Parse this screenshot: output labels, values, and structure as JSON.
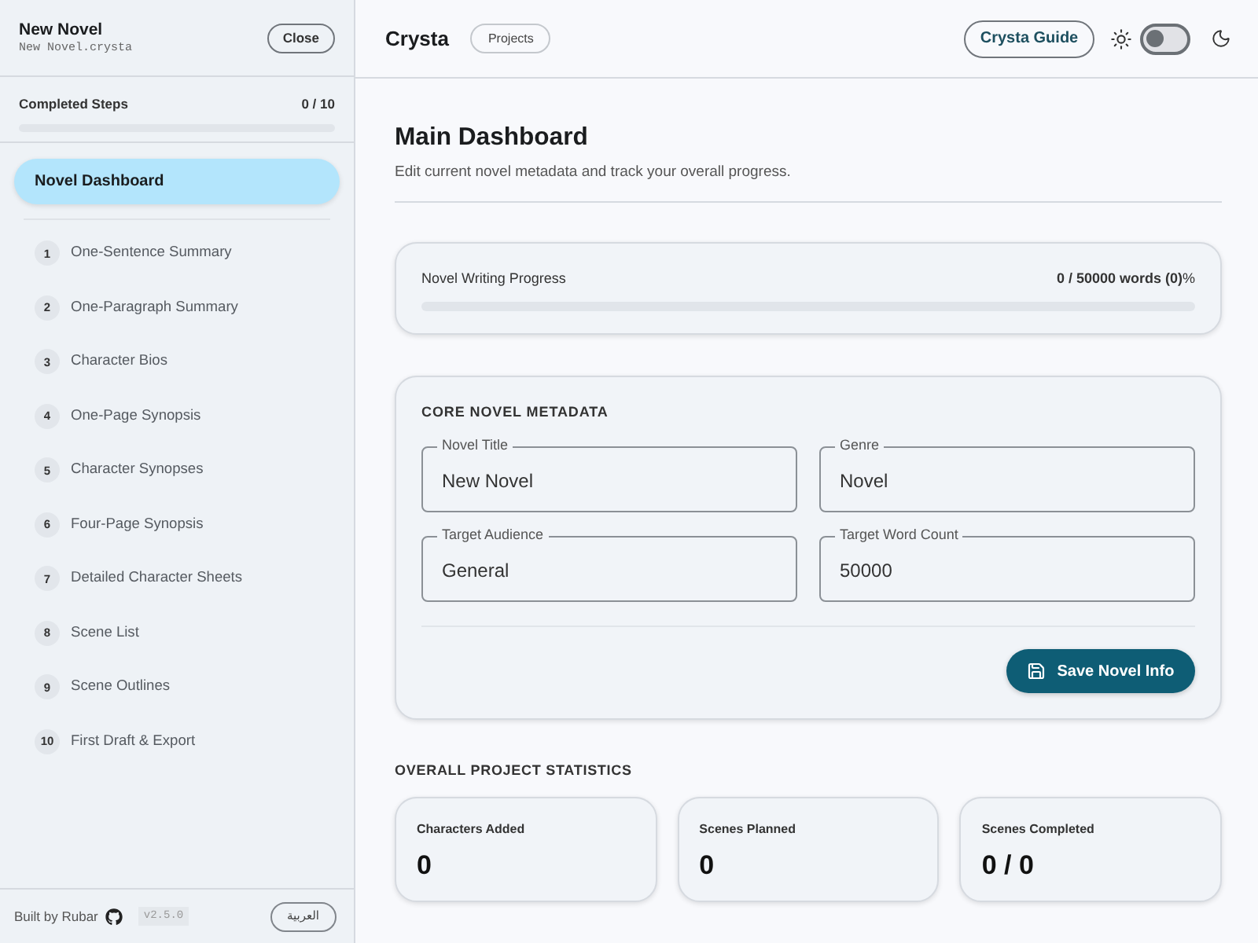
{
  "sidebar": {
    "project_title": "New Novel",
    "project_file": "New Novel.crysta",
    "close_button": "Close",
    "completed_steps": {
      "label": "Completed Steps",
      "count": "0 / 10"
    },
    "nav_items": [
      {
        "kind": "dashboard",
        "label": "Novel Dashboard",
        "selected": true
      },
      {
        "kind": "step",
        "number": "1",
        "label": "One-Sentence Summary",
        "selected": false
      },
      {
        "kind": "step",
        "number": "2",
        "label": "One-Paragraph Summary",
        "selected": false
      },
      {
        "kind": "step",
        "number": "3",
        "label": "Character Bios",
        "selected": false
      },
      {
        "kind": "step",
        "number": "4",
        "label": "One-Page Synopsis",
        "selected": false
      },
      {
        "kind": "step",
        "number": "5",
        "label": "Character Synopses",
        "selected": false
      },
      {
        "kind": "step",
        "number": "6",
        "label": "Four-Page Synopsis",
        "selected": false
      },
      {
        "kind": "step",
        "number": "7",
        "label": "Detailed Character Sheets",
        "selected": false
      },
      {
        "kind": "step",
        "number": "8",
        "label": "Scene List",
        "selected": false
      },
      {
        "kind": "step",
        "number": "9",
        "label": "Scene Outlines",
        "selected": false
      },
      {
        "kind": "step",
        "number": "10",
        "label": "First Draft & Export",
        "selected": false
      }
    ],
    "footer": {
      "credit": "Built by Rubar",
      "version": "v2.5.0",
      "language_button": "العربية"
    }
  },
  "header": {
    "app_name": "Crysta",
    "projects_button": "Projects",
    "guide_button": "Crysta Guide",
    "dark_mode": false
  },
  "dashboard": {
    "title": "Main Dashboard",
    "subtitle": "Edit current novel metadata and track your overall progress.",
    "writing_progress": {
      "label": "Novel Writing Progress",
      "reading": "**0 / 50000 words (0)**%"
    },
    "metadata": {
      "heading": "CORE NOVEL METADATA",
      "fields": [
        {
          "label": "Novel Title",
          "value": "New Novel"
        },
        {
          "label": "Genre",
          "value": "Novel"
        },
        {
          "label": "Target Audience",
          "value": "General"
        },
        {
          "label": "Target Word Count",
          "value": "50000"
        }
      ],
      "save_button": "Save Novel Info"
    },
    "statistics": {
      "heading": "OVERALL PROJECT STATISTICS",
      "cards": [
        {
          "label": "Characters Added",
          "value": "0"
        },
        {
          "label": "Scenes Planned",
          "value": "0"
        },
        {
          "label": "Scenes Completed",
          "value": "0 / 0"
        }
      ]
    }
  }
}
